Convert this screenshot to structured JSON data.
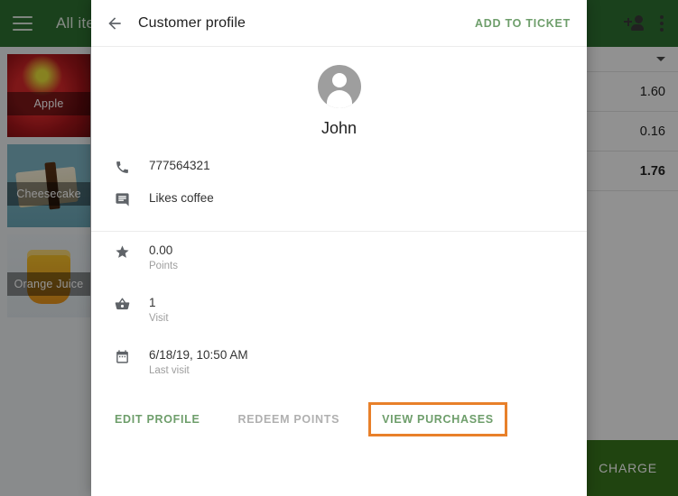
{
  "background": {
    "topbar": {
      "menu_icon": "hamburger-icon",
      "title": "All items",
      "add_customer_icon": "add-person-icon",
      "overflow_icon": "kebab-menu-icon"
    },
    "products": [
      {
        "name": "Apple"
      },
      {
        "name": "Cheesecake"
      },
      {
        "name": "Orange Juice"
      }
    ],
    "ticket": {
      "caret_icon": "chevron-down-icon",
      "rows": [
        {
          "value": "1.60",
          "bold": false
        },
        {
          "value": "0.16",
          "bold": false
        },
        {
          "value": "1.76",
          "bold": true
        }
      ],
      "charge_label": "CHARGE"
    }
  },
  "dialog": {
    "back_icon": "back-arrow-icon",
    "title": "Customer profile",
    "add_to_ticket_label": "ADD TO TICKET",
    "customer": {
      "avatar_icon": "person-avatar-icon",
      "name": "John"
    },
    "info": [
      {
        "icon": "phone-icon",
        "primary": "777564321",
        "secondary": ""
      },
      {
        "icon": "note-icon",
        "primary": "Likes coffee",
        "secondary": ""
      },
      {
        "icon": "star-icon",
        "primary": "0.00",
        "secondary": "Points"
      },
      {
        "icon": "basket-icon",
        "primary": "1",
        "secondary": "Visit"
      },
      {
        "icon": "calendar-icon",
        "primary": "6/18/19, 10:50 AM",
        "secondary": "Last visit"
      }
    ],
    "actions": {
      "edit_profile": "EDIT PROFILE",
      "redeem_points": "REDEEM POINTS",
      "view_purchases": "VIEW PURCHASES"
    }
  },
  "colors": {
    "brand_green": "#2e7031",
    "action_green": "#6e9e6b",
    "charge_green": "#38761d",
    "highlight_orange": "#e8802a",
    "disabled_gray": "#b0b0b0"
  }
}
